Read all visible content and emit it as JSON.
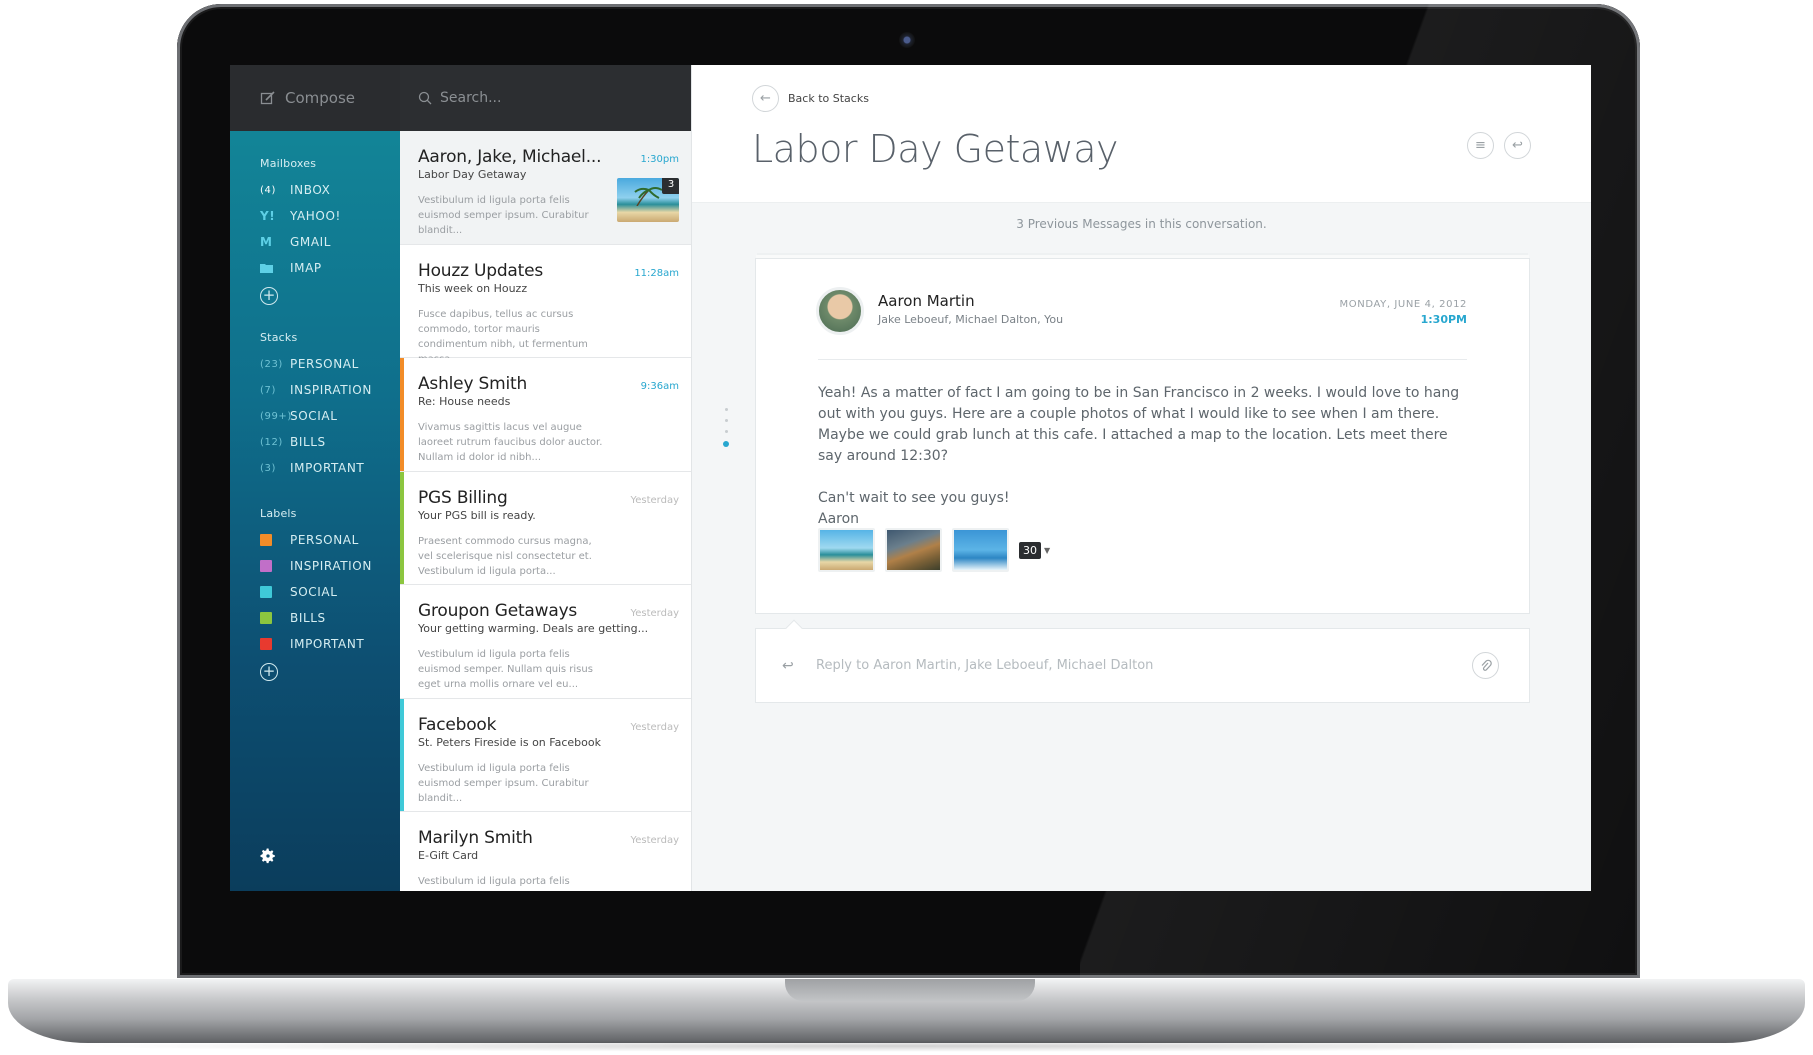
{
  "sidebar": {
    "compose_label": "Compose",
    "mailboxes_heading": "Mailboxes",
    "mailboxes": [
      {
        "count": "(4)",
        "label": "INBOX",
        "icon": "inbox-count"
      },
      {
        "label": "YAHOO!",
        "icon": "yahoo-icon"
      },
      {
        "label": "GMAIL",
        "icon": "gmail-icon"
      },
      {
        "label": "IMAP",
        "icon": "folder-icon"
      }
    ],
    "stacks_heading": "Stacks",
    "stacks": [
      {
        "count": "(23)",
        "label": "PERSONAL"
      },
      {
        "count": "(7)",
        "label": "INSPIRATION"
      },
      {
        "count": "(99+)",
        "label": "SOCIAL"
      },
      {
        "count": "(12)",
        "label": "BILLS"
      },
      {
        "count": "(3)",
        "label": "IMPORTANT"
      }
    ],
    "labels_heading": "Labels",
    "labels": [
      {
        "label": "PERSONAL",
        "color": "#f28c28"
      },
      {
        "label": "INSPIRATION",
        "color": "#c16fc8"
      },
      {
        "label": "SOCIAL",
        "color": "#3fc9d8"
      },
      {
        "label": "BILLS",
        "color": "#8cc63f"
      },
      {
        "label": "IMPORTANT",
        "color": "#e83a2f"
      }
    ]
  },
  "search": {
    "placeholder": "Search..."
  },
  "messages": [
    {
      "sender": "Aaron, Jake, Michael...",
      "time": "1:30pm",
      "subject": "Labor Day Getaway",
      "preview": "Vestibulum id ligula porta felis euismod semper ipsum. Curabitur blandit...",
      "thumb_count": "3",
      "accent": ""
    },
    {
      "sender": "Houzz Updates",
      "time": "11:28am",
      "subject": "This week on Houzz",
      "preview": "Fusce dapibus, tellus ac cursus commodo, tortor mauris condimentum nibh, ut fermentum massa...",
      "accent": ""
    },
    {
      "sender": "Ashley Smith",
      "time": "9:36am",
      "subject": "Re: House needs",
      "preview": "Vivamus sagittis lacus vel augue laoreet rutrum faucibus dolor auctor. Nullam id dolor id nibh...",
      "accent": "#f28c28"
    },
    {
      "sender": "PGS Billing",
      "time": "Yesterday",
      "subject": "Your PGS bill is ready.",
      "preview": "Praesent commodo cursus magna, vel scelerisque nisl consectetur et. Vestibulum id ligula porta...",
      "accent": "#8cc63f"
    },
    {
      "sender": "Groupon Getaways",
      "time": "Yesterday",
      "subject": "Your getting warming. Deals are getting...",
      "preview": "Vestibulum id ligula porta felis euismod semper. Nullam quis risus eget urna mollis ornare vel eu...",
      "accent": ""
    },
    {
      "sender": "Facebook",
      "time": "Yesterday",
      "subject": "St. Peters Fireside is on Facebook",
      "preview": "Vestibulum id ligula porta felis euismod semper ipsum. Curabitur blandit...",
      "accent": "#3fc9d8"
    },
    {
      "sender": "Marilyn Smith",
      "time": "Yesterday",
      "subject": "E-Gift Card",
      "preview": "Vestibulum id ligula porta felis euismod semper",
      "accent": ""
    }
  ],
  "reader": {
    "back_label": "Back to Stacks",
    "title": "Labor Day Getaway",
    "previous_messages": "3 Previous Messages in this conversation.",
    "email": {
      "from": "Aaron Martin",
      "recipients": "Jake Leboeuf, Michael Dalton, You",
      "date": "MONDAY, JUNE 4, 2012",
      "time": "1:30PM",
      "body_1": "Yeah! As a matter of fact I am going to be in San Francisco in 2 weeks. I would love to hang out with you guys. Here are a couple photos of what I would like to see when I am there. Maybe we could grab lunch at this cafe. I attached a map to the location. Lets meet there say around 12:30?",
      "body_2": "Can't wait to see you guys!",
      "signature": "Aaron",
      "attachment_count": "30"
    },
    "reply_placeholder": "Reply to Aaron Martin, Jake Leboeuf, Michael Dalton"
  },
  "colors": {
    "accent_blue": "#28a7cf"
  }
}
